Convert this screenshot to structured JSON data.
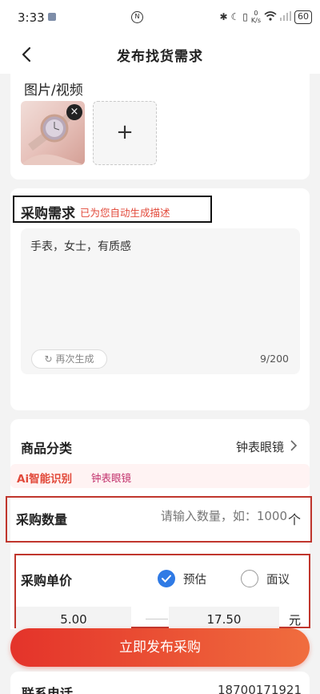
{
  "status_bar": {
    "time": "3:33",
    "net_speed_value": "0",
    "net_speed_unit": "K/s",
    "battery": "60"
  },
  "nav": {
    "title": "发布找货需求"
  },
  "media": {
    "title": "图片/视频",
    "remove_symbol": "×",
    "add_symbol": "+"
  },
  "requirement": {
    "title": "采购需求",
    "auto_hint": "已为您自动生成描述",
    "text": "手表，女士，有质感",
    "regenerate_label": "再次生成",
    "count": "9/200"
  },
  "category": {
    "label": "商品分类",
    "value": "钟表眼镜",
    "ai_tag": "Ai智能识别",
    "ai_value": "钟表眼镜"
  },
  "quantity": {
    "label": "采购数量",
    "placeholder": "请输入数量，如：1000",
    "unit": "个"
  },
  "unit_price": {
    "label": "采购单价",
    "option_estimate": "预估",
    "option_negotiable": "面议",
    "min": "5.00",
    "max": "17.50",
    "unit": "元"
  },
  "submit": {
    "label": "立即发布采购"
  },
  "contact": {
    "label": "联系电话",
    "value": "18700171921"
  },
  "colors": {
    "accent": "#e4332a",
    "radio_checked": "#2f7ae5",
    "ai_text": "#e2493a",
    "highlight_outline": "#c0362d"
  }
}
